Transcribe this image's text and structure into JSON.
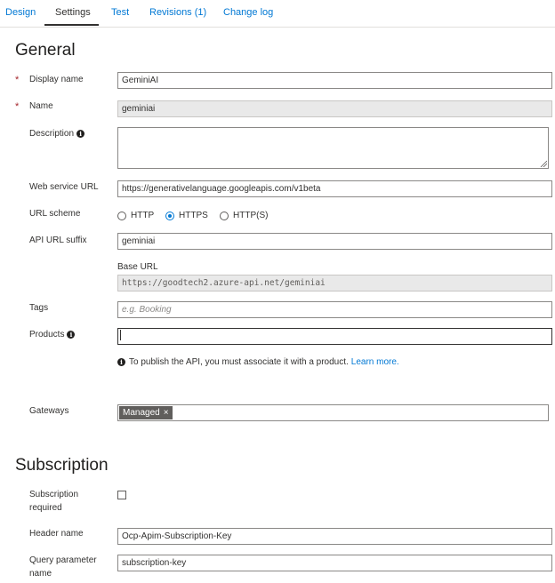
{
  "tabs": [
    {
      "label": "Design",
      "active": false
    },
    {
      "label": "Settings",
      "active": true
    },
    {
      "label": "Test",
      "active": false
    },
    {
      "label": "Revisions (1)",
      "active": false
    },
    {
      "label": "Change log",
      "active": false
    }
  ],
  "general": {
    "title": "General",
    "display_name": {
      "label": "Display name",
      "required": "*",
      "value": "GeminiAI"
    },
    "name": {
      "label": "Name",
      "required": "*",
      "value": "geminiai"
    },
    "description": {
      "label": "Description",
      "info_icon": "info-icon",
      "value": ""
    },
    "web_service_url": {
      "label": "Web service URL",
      "value": "https://generativelanguage.googleapis.com/v1beta"
    },
    "url_scheme": {
      "label": "URL scheme",
      "options": [
        {
          "label": "HTTP",
          "selected": false
        },
        {
          "label": "HTTPS",
          "selected": true
        },
        {
          "label": "HTTP(S)",
          "selected": false
        }
      ]
    },
    "api_url_suffix": {
      "label": "API URL suffix",
      "value": "geminiai"
    },
    "base_url": {
      "label": "Base URL",
      "value": "https://goodtech2.azure-api.net/geminiai"
    },
    "tags": {
      "label": "Tags",
      "placeholder": "e.g. Booking"
    },
    "products": {
      "label": "Products",
      "info_icon": "info-icon",
      "value": ""
    },
    "products_hint": {
      "text": "To publish the API, you must associate it with a product.",
      "link": "Learn more."
    },
    "gateways": {
      "label": "Gateways",
      "chip": "Managed",
      "chip_remove": "×"
    }
  },
  "subscription": {
    "title": "Subscription",
    "required": {
      "label_line1": "Subscription",
      "label_line2": "required",
      "checked": false
    },
    "header_name": {
      "label": "Header name",
      "value": "Ocp-Apim-Subscription-Key"
    },
    "query_param": {
      "label_line1": "Query parameter",
      "label_line2": "name",
      "value": "subscription-key"
    }
  },
  "colors": {
    "accent": "#0078d4",
    "required": "#a4262c",
    "chip": "#605e5c"
  }
}
